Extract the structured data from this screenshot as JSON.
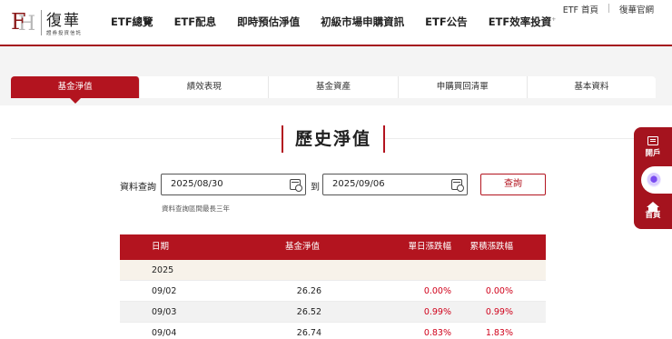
{
  "brand": {
    "name": "復華",
    "subtitle": "證券投資信託",
    "mark_f": "F",
    "mark_h": "H"
  },
  "nav": {
    "items": [
      "ETF總覽",
      "ETF配息",
      "即時預估淨值",
      "初級市場申購資訊",
      "ETF公告",
      "ETF效率投資"
    ],
    "sup": "+"
  },
  "toplinks": {
    "etf_home": "ETF 首頁",
    "official": "復華官網"
  },
  "tabs": [
    "基金淨值",
    "績效表現",
    "基金資產",
    "申購買回清單",
    "基本資料"
  ],
  "section_title": "歷史淨值",
  "query": {
    "label": "資料查詢",
    "start_date": "2025/08/30",
    "to_label": "到",
    "end_date": "2025/09/06",
    "button": "查詢",
    "note": "資料查詢區間最長三年"
  },
  "table": {
    "headers": [
      "日期",
      "基金淨值",
      "單日漲跌幅",
      "累積漲跌幅"
    ],
    "year": "2025",
    "rows": [
      {
        "date": "09/02",
        "nav": "26.26",
        "day": "0.00%",
        "cum": "0.00%"
      },
      {
        "date": "09/03",
        "nav": "26.52",
        "day": "0.99%",
        "cum": "0.99%"
      },
      {
        "date": "09/04",
        "nav": "26.74",
        "day": "0.83%",
        "cum": "1.83%"
      }
    ]
  },
  "side": {
    "open_account": "開戶",
    "home": "首頁"
  },
  "colors": {
    "brand_red": "#b3141f",
    "up_red": "#d0021b"
  }
}
